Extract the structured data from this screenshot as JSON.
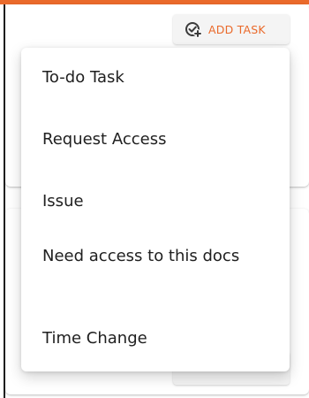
{
  "header": {
    "accent_color": "#ea6a2b",
    "add_task_label": "ADD TASK",
    "add_task_icon": "check-circle-plus-icon"
  },
  "menu": {
    "items": [
      {
        "label": "To-do Task"
      },
      {
        "label": "Request Access"
      },
      {
        "label": "Issue"
      },
      {
        "label": "Need access to this docs"
      },
      {
        "label": "Time Change"
      }
    ]
  }
}
